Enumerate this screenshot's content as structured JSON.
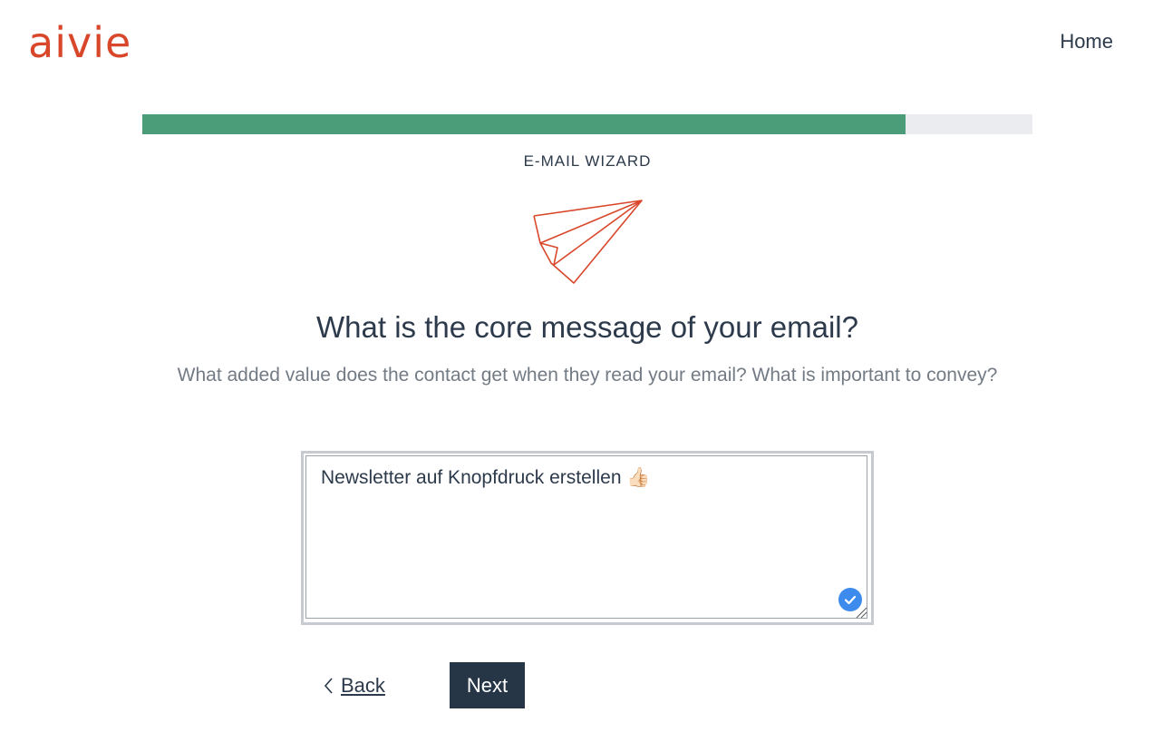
{
  "brand": {
    "logo_text": "aivie",
    "accent_color": "#d9472b"
  },
  "nav": {
    "home_label": "Home"
  },
  "progress": {
    "fraction": 0.857,
    "fill_color": "#4a9d78",
    "track_color": "#ebecf0"
  },
  "wizard": {
    "label": "E-MAIL WIZARD",
    "illustration_icon": "paper-plane-icon",
    "question": "What is the core message of your email?",
    "subtitle": "What added value does the contact get when they read your email? What is important to convey?"
  },
  "input": {
    "value": "Newsletter auf Knopfdruck erstellen 👍🏻",
    "badge_icon": "check-circle-icon",
    "badge_color": "#3d8bec"
  },
  "actions": {
    "back_label": "Back",
    "back_icon": "chevron-left-icon",
    "next_label": "Next",
    "next_color": "#263646"
  }
}
